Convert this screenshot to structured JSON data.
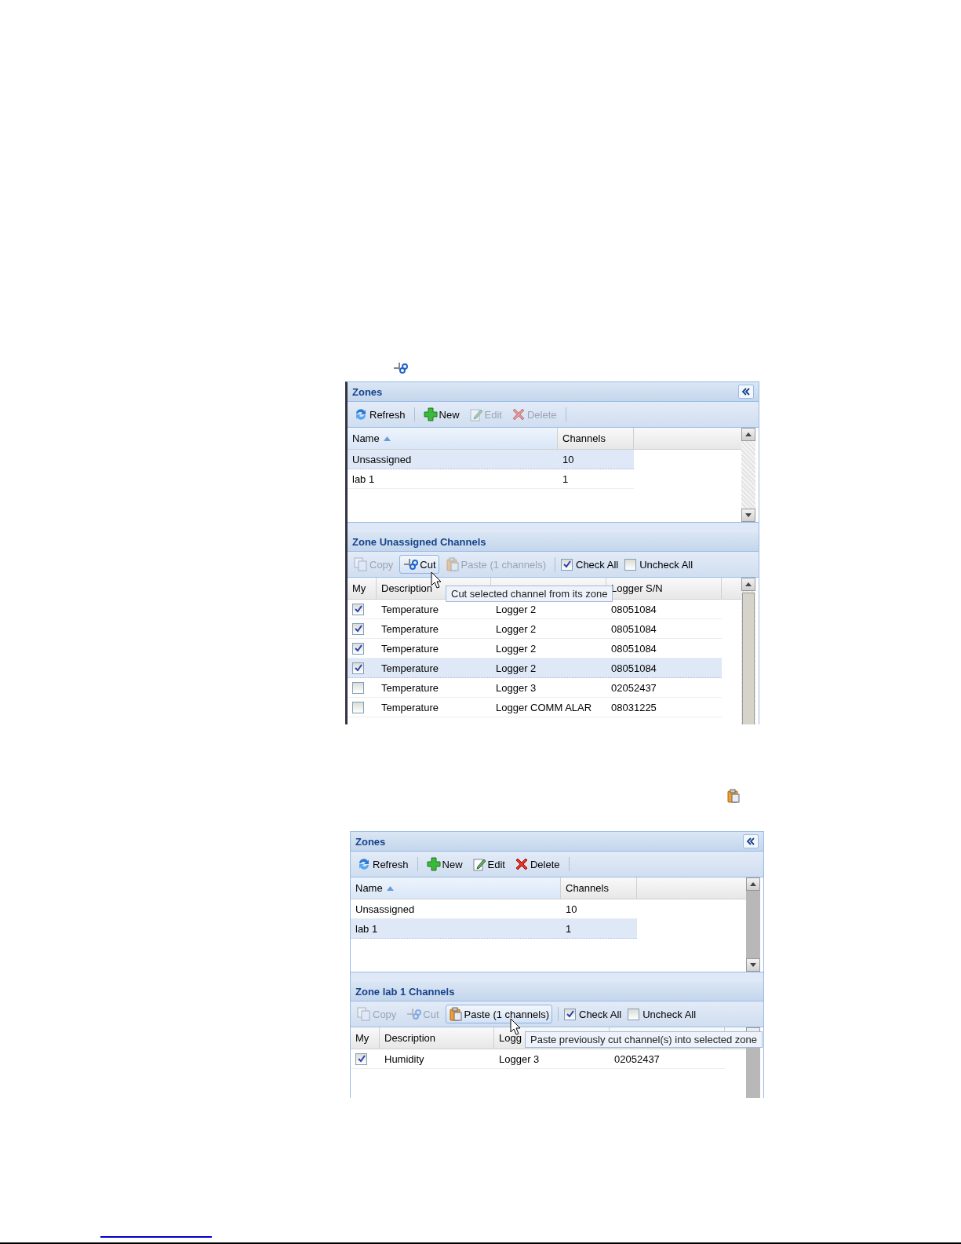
{
  "screenshots": [
    {
      "zones": {
        "title": "Zones",
        "toolbar": [
          {
            "kind": "refresh",
            "label": "Refresh",
            "disabled": false
          },
          {
            "kind": "separator"
          },
          {
            "kind": "new",
            "label": "New",
            "disabled": false
          },
          {
            "kind": "edit",
            "label": "Edit",
            "disabled": true
          },
          {
            "kind": "delete",
            "label": "Delete",
            "disabled": true
          },
          {
            "kind": "separator"
          }
        ],
        "columns": [
          {
            "label": "Name",
            "sorted": true
          },
          {
            "label": "Channels",
            "sorted": false
          }
        ],
        "rows": [
          {
            "cells": [
              "Unsassigned",
              "10"
            ],
            "selected": true
          },
          {
            "cells": [
              "lab 1",
              "1"
            ],
            "selected": false
          }
        ]
      },
      "channels": {
        "title": "Zone Unassigned Channels",
        "toolbar": [
          {
            "kind": "copy",
            "label": "Copy",
            "disabled": true,
            "hovered": false
          },
          {
            "kind": "cut",
            "label": "Cut",
            "disabled": false,
            "hovered": true
          },
          {
            "kind": "paste",
            "label": "Paste (1 channels)",
            "disabled": true,
            "hovered": false
          },
          {
            "kind": "separator"
          },
          {
            "kind": "checkbox",
            "label": "Check All",
            "checked": true
          },
          {
            "kind": "checkbox",
            "label": "Uncheck All",
            "checked": false
          }
        ],
        "columns": [
          {
            "label": "My"
          },
          {
            "label": "Description"
          },
          {},
          {
            "label": "Logger S/N"
          }
        ],
        "rows": [
          {
            "checked": true,
            "selected": false,
            "cells": [
              "",
              "Temperature",
              "Logger 2",
              "08051084"
            ]
          },
          {
            "checked": true,
            "selected": false,
            "cells": [
              "",
              "Temperature",
              "Logger 2",
              "08051084"
            ]
          },
          {
            "checked": true,
            "selected": false,
            "cells": [
              "",
              "Temperature",
              "Logger 2",
              "08051084"
            ]
          },
          {
            "checked": true,
            "selected": true,
            "cells": [
              "",
              "Temperature",
              "Logger 2",
              "08051084"
            ]
          },
          {
            "checked": false,
            "selected": false,
            "cells": [
              "",
              "Temperature",
              "Logger 3",
              "02052437"
            ]
          },
          {
            "checked": false,
            "selected": false,
            "cells": [
              "",
              "Temperature",
              "Logger COMM ALAR",
              "08031225"
            ]
          }
        ],
        "tooltip": "Cut selected channel from its zone"
      }
    },
    {
      "zones": {
        "title": "Zones",
        "toolbar": [
          {
            "kind": "refresh",
            "label": "Refresh",
            "disabled": false
          },
          {
            "kind": "separator"
          },
          {
            "kind": "new",
            "label": "New",
            "disabled": false
          },
          {
            "kind": "edit",
            "label": "Edit",
            "disabled": false
          },
          {
            "kind": "delete",
            "label": "Delete",
            "disabled": false
          },
          {
            "kind": "separator"
          }
        ],
        "columns": [
          {
            "label": "Name",
            "sorted": true
          },
          {
            "label": "Channels",
            "sorted": false
          }
        ],
        "rows": [
          {
            "cells": [
              "Unsassigned",
              "10"
            ],
            "selected": false
          },
          {
            "cells": [
              "lab 1",
              "1"
            ],
            "selected": true
          }
        ]
      },
      "channels": {
        "title": "Zone lab 1 Channels",
        "toolbar": [
          {
            "kind": "copy",
            "label": "Copy",
            "disabled": true,
            "hovered": false
          },
          {
            "kind": "cut",
            "label": "Cut",
            "disabled": true,
            "hovered": false
          },
          {
            "kind": "paste",
            "label": "Paste (1 channels)",
            "disabled": false,
            "hovered": true
          },
          {
            "kind": "separator"
          },
          {
            "kind": "checkbox",
            "label": "Check All",
            "checked": true
          },
          {
            "kind": "checkbox",
            "label": "Uncheck All",
            "checked": false
          }
        ],
        "columns": [
          {
            "label": "My"
          },
          {
            "label": "Description"
          },
          {
            "label": "Logg"
          },
          {}
        ],
        "rows": [
          {
            "checked": true,
            "selected": false,
            "cells": [
              "",
              "Humidity",
              "Logger 3",
              "02052437"
            ]
          }
        ],
        "tooltip": "Paste previously cut channel(s) into selected zone"
      }
    }
  ]
}
